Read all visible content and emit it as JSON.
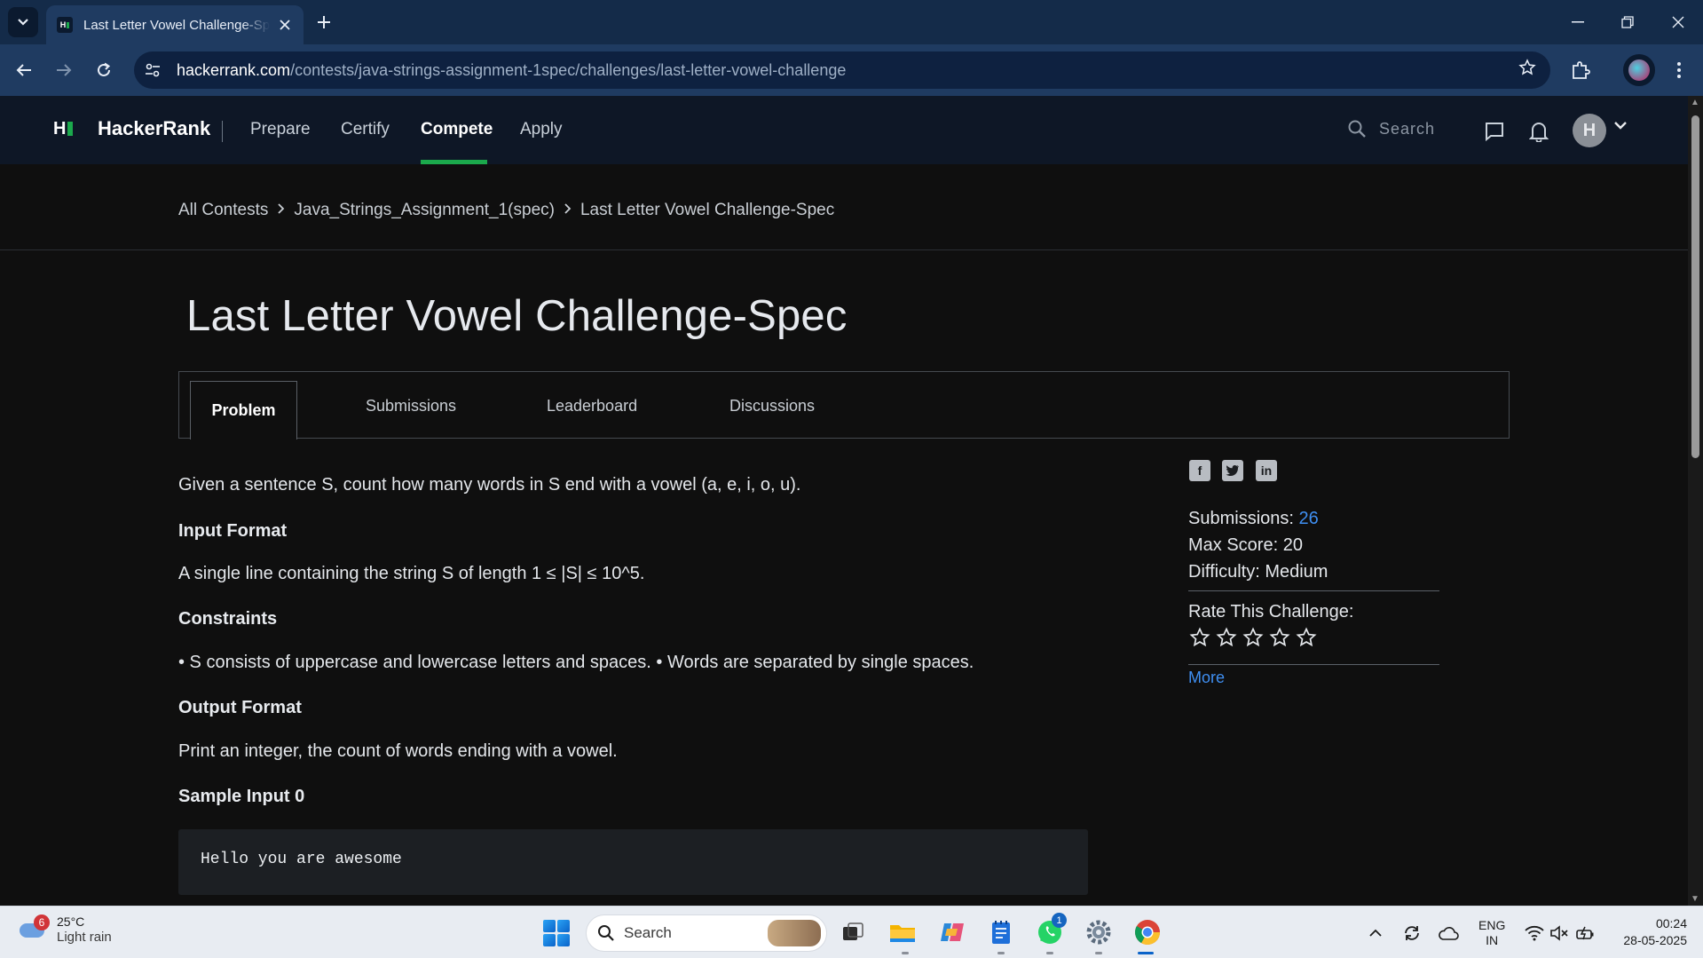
{
  "browser": {
    "tab_title": "Last Letter Vowel Challenge-Spec",
    "url_host": "hackerrank.com",
    "url_path": "/contests/java-strings-assignment-1spec/challenges/last-letter-vowel-challenge"
  },
  "site": {
    "brand": "HackerRank",
    "nav": [
      "Prepare",
      "Certify",
      "Compete",
      "Apply"
    ],
    "active_nav": "Compete",
    "search_placeholder": "Search",
    "avatar_letter": "H"
  },
  "breadcrumb": [
    "All Contests",
    "Java_Strings_Assignment_1(spec)",
    "Last Letter Vowel Challenge-Spec"
  ],
  "challenge": {
    "title": "Last Letter Vowel Challenge-Spec",
    "tabs": [
      "Problem",
      "Submissions",
      "Leaderboard",
      "Discussions"
    ],
    "active_tab": "Problem",
    "statement": "Given a sentence S, count how many words in S end with a vowel (a, e, i, o, u).",
    "input_heading": "Input Format",
    "input_text": "A single line containing the string S of length 1 ≤ |S| ≤ 10^5.",
    "constraints_heading": "Constraints",
    "constraints_text": "• S consists of uppercase and lowercase letters and spaces. • Words are separated by single spaces.",
    "output_heading": "Output Format",
    "output_text": "Print an integer, the count of words ending with a vowel.",
    "sample_heading": "Sample Input 0",
    "sample_input": "Hello you are awesome"
  },
  "sidebar": {
    "submissions_label": "Submissions:",
    "submissions_value": "26",
    "max_score_label": "Max Score:",
    "max_score_value": "20",
    "difficulty_label": "Difficulty:",
    "difficulty_value": "Medium",
    "rate_label": "Rate This Challenge:",
    "rating_stars_total": 5,
    "rating_stars_filled": 0,
    "more_link": "More",
    "social_icons": [
      "facebook-icon",
      "twitter-icon",
      "linkedin-icon"
    ]
  },
  "taskbar": {
    "weather_temp": "25°C",
    "weather_desc": "Light rain",
    "weather_badge": "6",
    "search_placeholder": "Search",
    "whatsapp_badge": "1",
    "lang_line1": "ENG",
    "lang_line2": "IN",
    "time": "00:24",
    "date": "28-05-2025"
  },
  "colors": {
    "accent_green": "#1ba94c",
    "link_blue": "#3f8ff2",
    "page_bg": "#0f0f0f",
    "nav_bg": "#0e1726"
  }
}
